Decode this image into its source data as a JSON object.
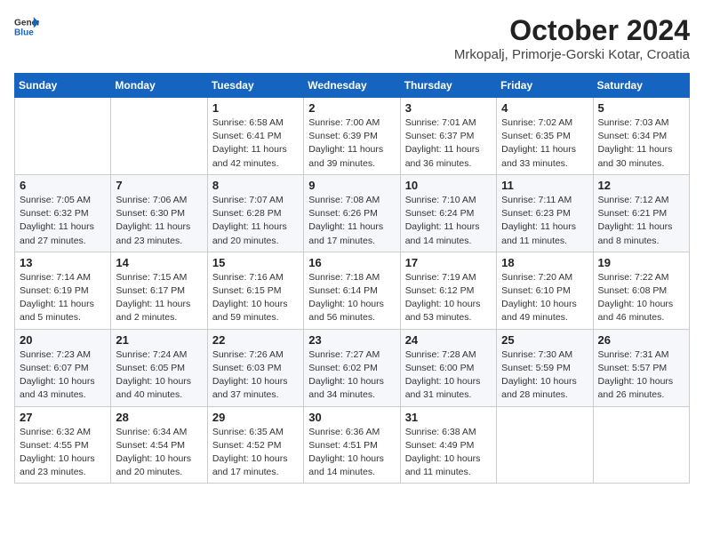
{
  "header": {
    "logo_general": "General",
    "logo_blue": "Blue",
    "month_title": "October 2024",
    "location": "Mrkopalj, Primorje-Gorski Kotar, Croatia"
  },
  "weekdays": [
    "Sunday",
    "Monday",
    "Tuesday",
    "Wednesday",
    "Thursday",
    "Friday",
    "Saturday"
  ],
  "weeks": [
    [
      {
        "day": "",
        "detail": ""
      },
      {
        "day": "",
        "detail": ""
      },
      {
        "day": "1",
        "detail": "Sunrise: 6:58 AM\nSunset: 6:41 PM\nDaylight: 11 hours and 42 minutes."
      },
      {
        "day": "2",
        "detail": "Sunrise: 7:00 AM\nSunset: 6:39 PM\nDaylight: 11 hours and 39 minutes."
      },
      {
        "day": "3",
        "detail": "Sunrise: 7:01 AM\nSunset: 6:37 PM\nDaylight: 11 hours and 36 minutes."
      },
      {
        "day": "4",
        "detail": "Sunrise: 7:02 AM\nSunset: 6:35 PM\nDaylight: 11 hours and 33 minutes."
      },
      {
        "day": "5",
        "detail": "Sunrise: 7:03 AM\nSunset: 6:34 PM\nDaylight: 11 hours and 30 minutes."
      }
    ],
    [
      {
        "day": "6",
        "detail": "Sunrise: 7:05 AM\nSunset: 6:32 PM\nDaylight: 11 hours and 27 minutes."
      },
      {
        "day": "7",
        "detail": "Sunrise: 7:06 AM\nSunset: 6:30 PM\nDaylight: 11 hours and 23 minutes."
      },
      {
        "day": "8",
        "detail": "Sunrise: 7:07 AM\nSunset: 6:28 PM\nDaylight: 11 hours and 20 minutes."
      },
      {
        "day": "9",
        "detail": "Sunrise: 7:08 AM\nSunset: 6:26 PM\nDaylight: 11 hours and 17 minutes."
      },
      {
        "day": "10",
        "detail": "Sunrise: 7:10 AM\nSunset: 6:24 PM\nDaylight: 11 hours and 14 minutes."
      },
      {
        "day": "11",
        "detail": "Sunrise: 7:11 AM\nSunset: 6:23 PM\nDaylight: 11 hours and 11 minutes."
      },
      {
        "day": "12",
        "detail": "Sunrise: 7:12 AM\nSunset: 6:21 PM\nDaylight: 11 hours and 8 minutes."
      }
    ],
    [
      {
        "day": "13",
        "detail": "Sunrise: 7:14 AM\nSunset: 6:19 PM\nDaylight: 11 hours and 5 minutes."
      },
      {
        "day": "14",
        "detail": "Sunrise: 7:15 AM\nSunset: 6:17 PM\nDaylight: 11 hours and 2 minutes."
      },
      {
        "day": "15",
        "detail": "Sunrise: 7:16 AM\nSunset: 6:15 PM\nDaylight: 10 hours and 59 minutes."
      },
      {
        "day": "16",
        "detail": "Sunrise: 7:18 AM\nSunset: 6:14 PM\nDaylight: 10 hours and 56 minutes."
      },
      {
        "day": "17",
        "detail": "Sunrise: 7:19 AM\nSunset: 6:12 PM\nDaylight: 10 hours and 53 minutes."
      },
      {
        "day": "18",
        "detail": "Sunrise: 7:20 AM\nSunset: 6:10 PM\nDaylight: 10 hours and 49 minutes."
      },
      {
        "day": "19",
        "detail": "Sunrise: 7:22 AM\nSunset: 6:08 PM\nDaylight: 10 hours and 46 minutes."
      }
    ],
    [
      {
        "day": "20",
        "detail": "Sunrise: 7:23 AM\nSunset: 6:07 PM\nDaylight: 10 hours and 43 minutes."
      },
      {
        "day": "21",
        "detail": "Sunrise: 7:24 AM\nSunset: 6:05 PM\nDaylight: 10 hours and 40 minutes."
      },
      {
        "day": "22",
        "detail": "Sunrise: 7:26 AM\nSunset: 6:03 PM\nDaylight: 10 hours and 37 minutes."
      },
      {
        "day": "23",
        "detail": "Sunrise: 7:27 AM\nSunset: 6:02 PM\nDaylight: 10 hours and 34 minutes."
      },
      {
        "day": "24",
        "detail": "Sunrise: 7:28 AM\nSunset: 6:00 PM\nDaylight: 10 hours and 31 minutes."
      },
      {
        "day": "25",
        "detail": "Sunrise: 7:30 AM\nSunset: 5:59 PM\nDaylight: 10 hours and 28 minutes."
      },
      {
        "day": "26",
        "detail": "Sunrise: 7:31 AM\nSunset: 5:57 PM\nDaylight: 10 hours and 26 minutes."
      }
    ],
    [
      {
        "day": "27",
        "detail": "Sunrise: 6:32 AM\nSunset: 4:55 PM\nDaylight: 10 hours and 23 minutes."
      },
      {
        "day": "28",
        "detail": "Sunrise: 6:34 AM\nSunset: 4:54 PM\nDaylight: 10 hours and 20 minutes."
      },
      {
        "day": "29",
        "detail": "Sunrise: 6:35 AM\nSunset: 4:52 PM\nDaylight: 10 hours and 17 minutes."
      },
      {
        "day": "30",
        "detail": "Sunrise: 6:36 AM\nSunset: 4:51 PM\nDaylight: 10 hours and 14 minutes."
      },
      {
        "day": "31",
        "detail": "Sunrise: 6:38 AM\nSunset: 4:49 PM\nDaylight: 10 hours and 11 minutes."
      },
      {
        "day": "",
        "detail": ""
      },
      {
        "day": "",
        "detail": ""
      }
    ]
  ]
}
